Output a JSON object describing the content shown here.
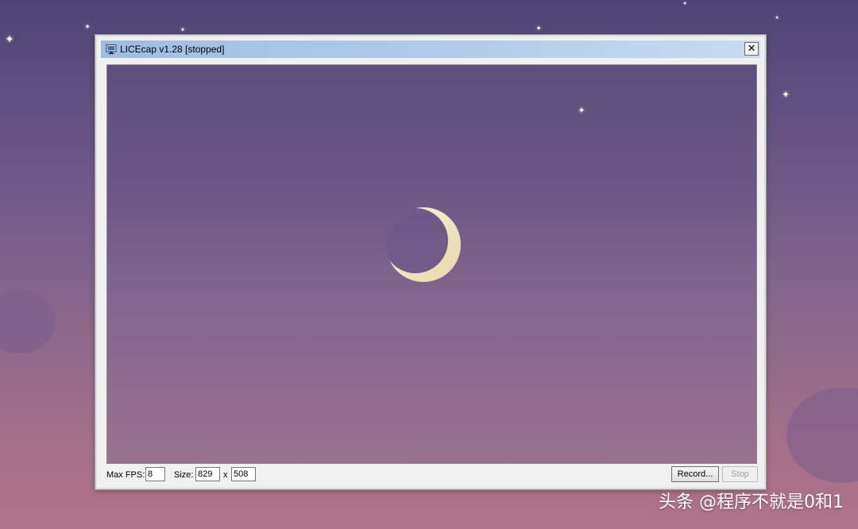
{
  "window": {
    "title": "LICEcap v1.28 [stopped]",
    "close_glyph": "✕"
  },
  "controls": {
    "max_fps_label": "Max FPS:",
    "max_fps_value": "8",
    "size_label": "Size:",
    "width_value": "829",
    "size_separator": "x",
    "height_value": "508",
    "record_button": "Record...",
    "stop_button": "Stop"
  },
  "icons": {
    "app": "monitor-icon",
    "close": "close-icon",
    "moon": "crescent-moon-icon",
    "star": "sparkle-star-icon"
  },
  "colors": {
    "titlebar": "#b6cde9",
    "window_bg": "#f0f0f0",
    "moon": "#f3e6c4",
    "sky_top": "#4e4474",
    "sky_bottom": "#b0728a"
  },
  "star_glyph": "✦",
  "watermark": "头条 @程序不就是0和1"
}
